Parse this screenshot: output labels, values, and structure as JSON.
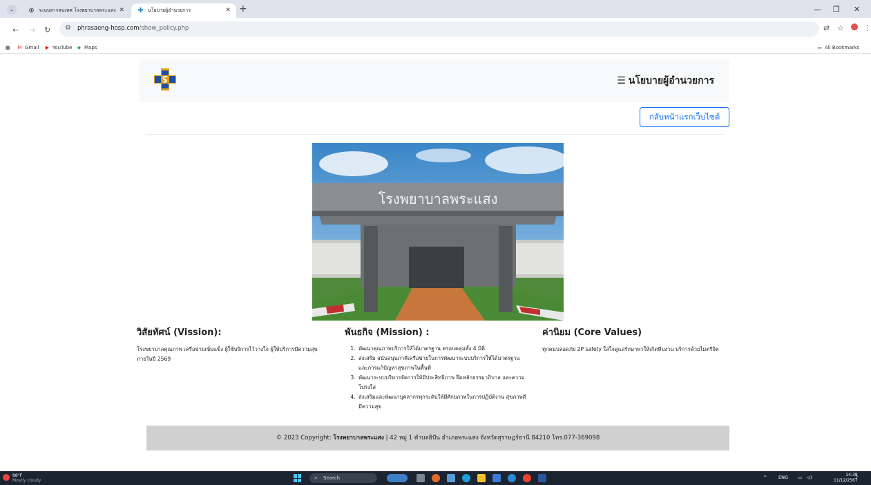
{
  "browser": {
    "tabs": [
      {
        "title": "ระบบสารสนเทศ โรงพยาบาลพระแสง",
        "active": false
      },
      {
        "title": "นโยบายผู้อำนวยการ",
        "active": true
      }
    ],
    "url_domain": "phrasaeng-hosp.com",
    "url_path": "/show_policy.php",
    "bookmarks": [
      "Gmail",
      "YouTube",
      "Maps"
    ],
    "all_bookmarks": "All Bookmarks"
  },
  "header": {
    "title": "นโยบายผู้อำนวยการ",
    "home_button": "กลับหน้าแรกเว็บไซต์"
  },
  "photo": {
    "sign_text": "โรงพยาบาลพระแสง"
  },
  "vision": {
    "heading": "วิสัยทัศน์ (Vission):",
    "text": "โรงพยาบาลคุณภาพ เครือข่ายเข้มแข็ง ผู้ใช้บริการไว้วางใจ ผู้ให้บริการมีความสุข ภายในปี 2569"
  },
  "mission": {
    "heading": "พันธกิจ (Mission) :",
    "items": [
      "พัฒนาคุณภาพบริการให้ได้มาตรฐาน ครอบคลุมทั้ง 4 มิติ",
      "ส่งเสริม สนับสนุนภาคีเครือข่ายในการพัฒนาระบบบริการให้ได้มาตรฐาน และการแก้ปัญหาสุขภาพในพื้นที่",
      "พัฒนาระบบบริหารจัดการให้มีประสิทธิภาพ ยึดหลักธรรมาภิบาล และความโปร่งใส",
      "ส่งเสริมและพัฒนาบุคลากรทุกระดับให้มีศักยภาพในการปฏิบัติงาน สุขภาพดี มีความสุข"
    ]
  },
  "values": {
    "heading": "ค่านิยม (Core Values)",
    "text": "ทุกคนปลอดภัย 2P safety ใส่ใจดูแลรักษาพาให้เกิดทีมงาน บริการด้วยไมตรีจิต"
  },
  "footer": {
    "prefix": "© 2023 Copyright: ",
    "hospital": "โรงพยาบาลพระแสง",
    "address": " | 42 หมู่ 1 ตำบลอิปัน อำเภอพระแสง จังหวัดสุราษฎร์ธานี 84210 โทร.077-369098"
  },
  "taskbar": {
    "temp": "88°F",
    "weather": "Mostly cloudy",
    "search": "Search",
    "lang": "ENG",
    "time": "14:38",
    "date": "11/12/2567"
  }
}
